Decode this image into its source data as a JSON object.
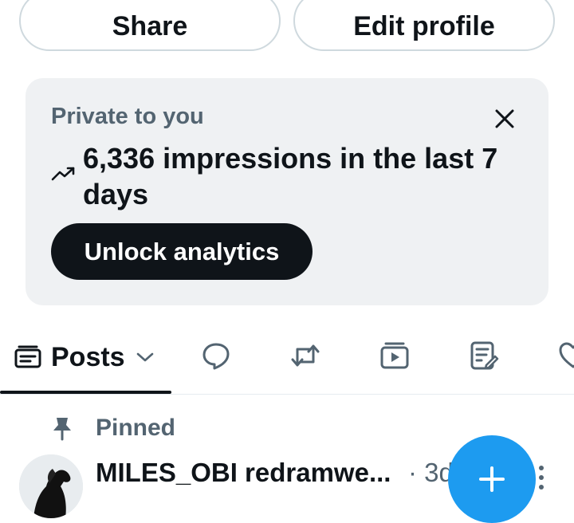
{
  "profile_actions": {
    "share_label": "Share",
    "edit_profile_label": "Edit profile"
  },
  "analytics_card": {
    "private_label": "Private to you",
    "impressions_text": "6,336 impressions in the last 7 days",
    "unlock_label": "Unlock analytics"
  },
  "tabs": {
    "active_label": "Posts",
    "items": [
      {
        "icon": "posts-icon",
        "label": "Posts"
      },
      {
        "icon": "reply-icon"
      },
      {
        "icon": "repost-icon"
      },
      {
        "icon": "video-icon"
      },
      {
        "icon": "articles-icon"
      },
      {
        "icon": "heart-icon"
      }
    ]
  },
  "pinned": {
    "label": "Pinned"
  },
  "post": {
    "author": "MILES_OBI redramwe...",
    "time": "· 3d"
  },
  "colors": {
    "accent": "#1d9bf0",
    "text_primary": "#0f1419",
    "text_secondary": "#536471",
    "card_bg": "#eff1f3"
  }
}
